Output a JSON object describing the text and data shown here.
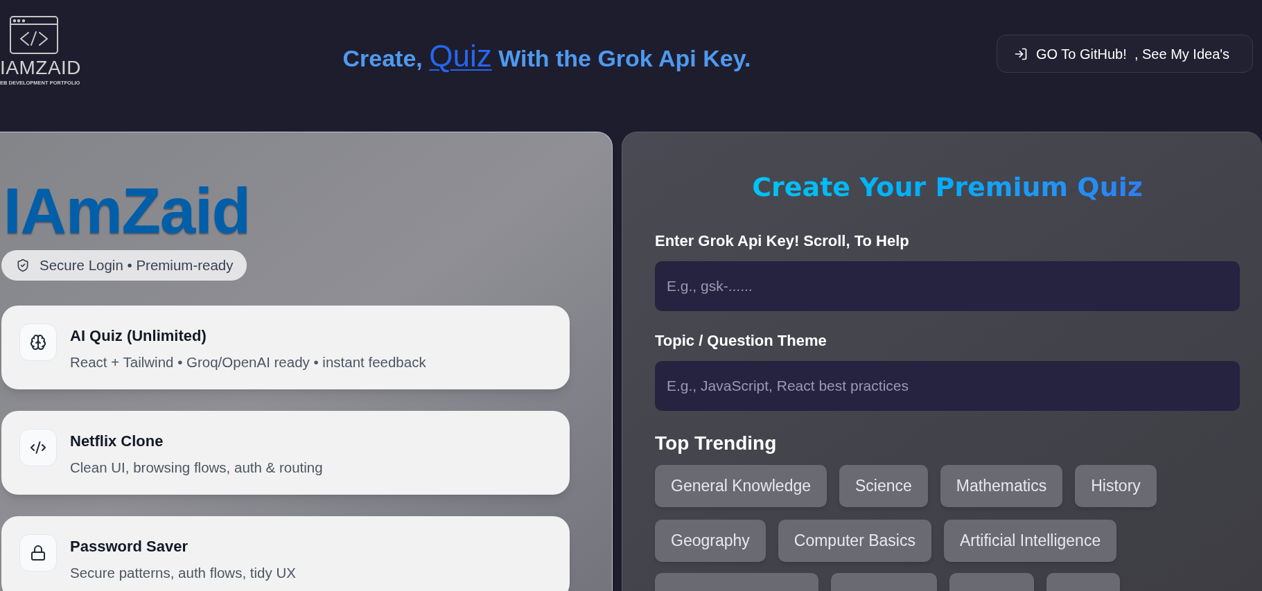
{
  "header": {
    "logo": {
      "wordmark": "IAMZAID",
      "tagline": "EB DEVELOPMENT PORTFOLIO"
    },
    "title": {
      "before": "Create,",
      "highlight": "Quiz",
      "after": "With the Grok Api Key."
    },
    "github_button": {
      "label": "GO To GitHub!  , See My Idea's"
    }
  },
  "profile_panel": {
    "brand": "IAmZaid",
    "badge": "Secure Login • Premium-ready",
    "projects": [
      {
        "title": "AI Quiz (Unlimited)",
        "description": "React + Tailwind • Groq/OpenAI ready • instant feedback"
      },
      {
        "title": "Netflix Clone",
        "description": "Clean UI, browsing flows, auth & routing"
      },
      {
        "title": "Password Saver",
        "description": "Secure patterns, auth flows, tidy UX"
      }
    ]
  },
  "quiz_panel": {
    "title": "Create Your Premium Quiz",
    "fields": [
      {
        "label": "Enter Grok Api Key! Scroll, To Help",
        "placeholder": "E.g., gsk-......"
      },
      {
        "label": "Topic / Question Theme",
        "placeholder": "E.g., JavaScript, React best practices"
      }
    ],
    "trending": {
      "heading": "Top Trending",
      "topics": [
        {
          "label": "General Knowledge"
        },
        {
          "label": "Science"
        },
        {
          "label": "Mathematics"
        },
        {
          "label": "History"
        },
        {
          "label": "Geography"
        },
        {
          "label": "Computer Basics"
        },
        {
          "label": "Artificial Intelligence"
        }
      ],
      "cut_off_topics": [
        {
          "kind": "chip"
        },
        {
          "kind": "chip"
        },
        {
          "kind": "chip"
        },
        {
          "kind": "chip"
        }
      ]
    }
  }
}
